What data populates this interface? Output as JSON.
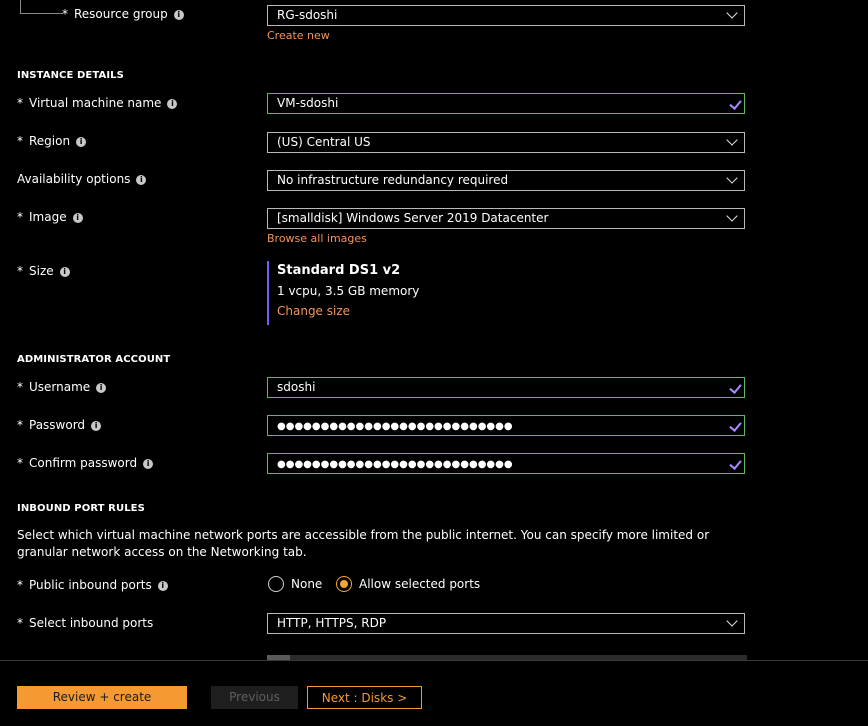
{
  "project": {
    "resource_group": {
      "label": "Resource group",
      "value": "RG-sdoshi",
      "create_new": "Create new"
    }
  },
  "instance": {
    "heading": "INSTANCE DETAILS",
    "vm_name": {
      "label": "Virtual machine name",
      "value": "VM-sdoshi"
    },
    "region": {
      "label": "Region",
      "value": "(US) Central US"
    },
    "availability": {
      "label": "Availability options",
      "value": "No infrastructure redundancy required"
    },
    "image": {
      "label": "Image",
      "value": "[smalldisk] Windows Server 2019 Datacenter",
      "browse": "Browse all images"
    },
    "size": {
      "label": "Size",
      "name": "Standard DS1 v2",
      "desc": "1 vcpu, 3.5 GB memory",
      "change": "Change size"
    }
  },
  "admin": {
    "heading": "ADMINISTRATOR ACCOUNT",
    "username": {
      "label": "Username",
      "value": "sdoshi"
    },
    "password": {
      "label": "Password",
      "value": "●●●●●●●●●●●●●●●●●●●●●●●●●●●"
    },
    "confirm": {
      "label": "Confirm password",
      "value": "●●●●●●●●●●●●●●●●●●●●●●●●●●●"
    }
  },
  "inbound": {
    "heading": "INBOUND PORT RULES",
    "description": "Select which virtual machine network ports are accessible from the public internet. You can specify more limited or granular network access on the Networking tab.",
    "public_ports": {
      "label": "Public inbound ports",
      "options": [
        "None",
        "Allow selected ports"
      ],
      "selected": "Allow selected ports"
    },
    "select_ports": {
      "label": "Select inbound ports",
      "value": "HTTP, HTTPS, RDP"
    }
  },
  "footer": {
    "review": "Review + create",
    "previous": "Previous",
    "next": "Next : Disks >"
  },
  "colors": {
    "accent": "#f59a32",
    "link": "#f1945a",
    "valid_border": "#5fb85f",
    "check": "#a98bff",
    "size_bar": "#7d5cf2"
  }
}
